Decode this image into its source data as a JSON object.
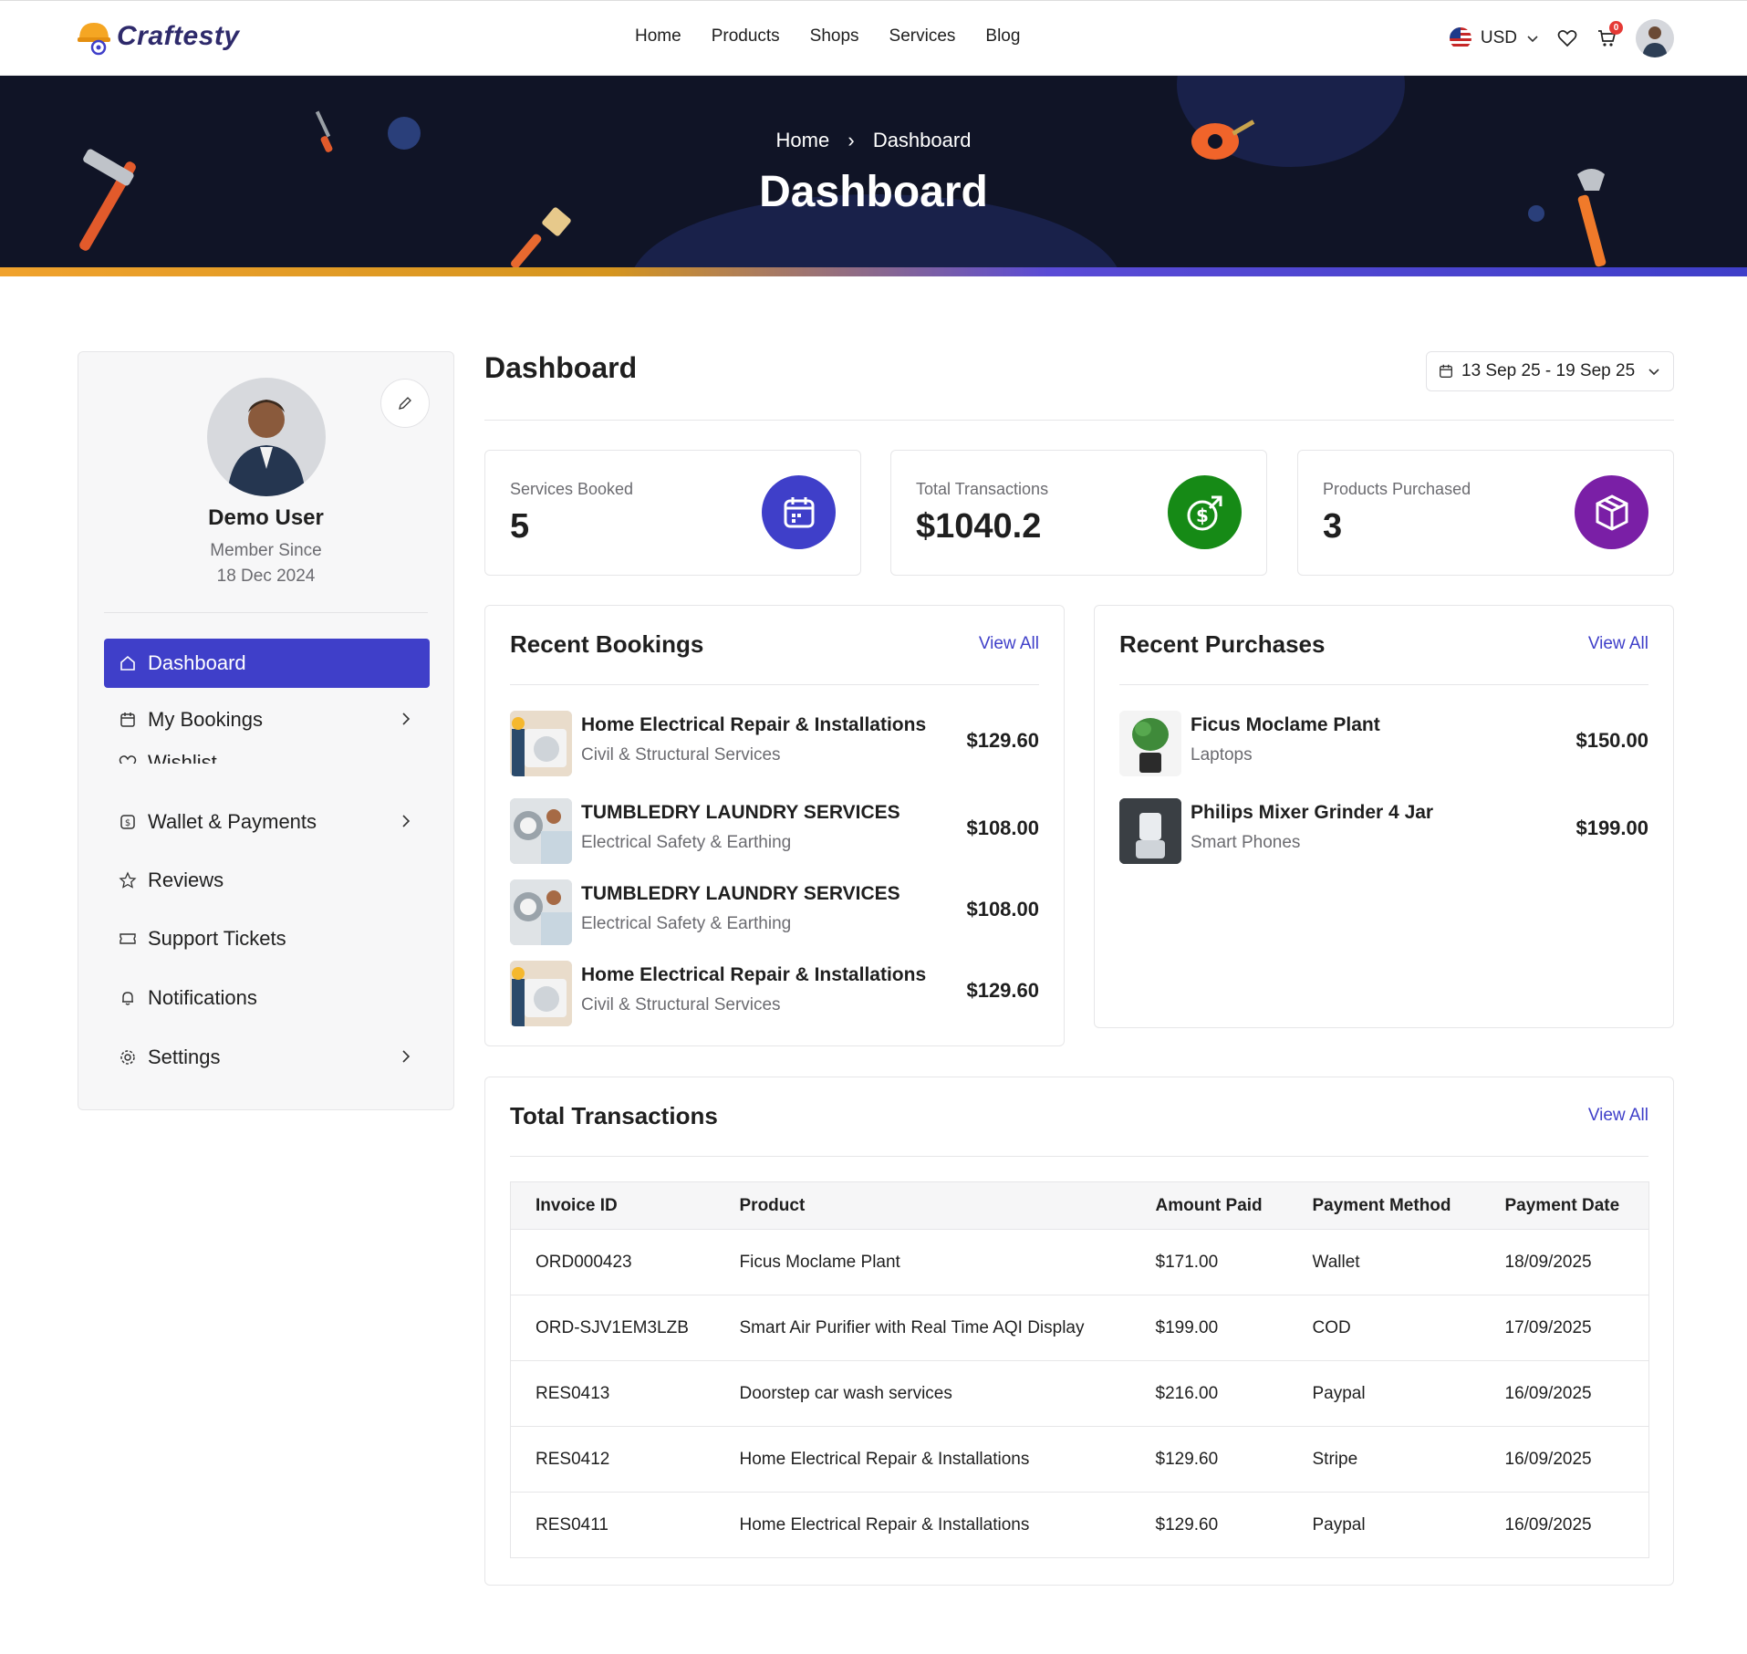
{
  "header": {
    "logo_text": "Craftesty",
    "nav": [
      "Home",
      "Products",
      "Shops",
      "Services",
      "Blog"
    ],
    "currency": "USD",
    "cart_count": "0"
  },
  "hero": {
    "breadcrumb_home": "Home",
    "breadcrumb_current": "Dashboard",
    "title": "Dashboard"
  },
  "sidebar": {
    "name": "Demo User",
    "member_since_label": "Member Since",
    "member_since_date": "18 Dec 2024",
    "items": [
      {
        "label": "Dashboard"
      },
      {
        "label": "My Bookings"
      },
      {
        "label": "Wishlist"
      },
      {
        "label": "Wallet & Payments"
      },
      {
        "label": "Reviews"
      },
      {
        "label": "Support Tickets"
      },
      {
        "label": "Notifications"
      },
      {
        "label": "Settings"
      }
    ]
  },
  "main": {
    "title": "Dashboard",
    "date_range": "13 Sep 25 - 19 Sep 25",
    "stats": [
      {
        "label": "Services Booked",
        "value": "5",
        "color": "#3f3fc9"
      },
      {
        "label": "Total Transactions",
        "value": "$1040.2",
        "color": "#168a16"
      },
      {
        "label": "Products Purchased",
        "value": "3",
        "color": "#7a1fa6"
      }
    ]
  },
  "bookings": {
    "title": "Recent Bookings",
    "view_all": "View All",
    "items": [
      {
        "title": "Home Electrical Repair & Installations",
        "sub": "Civil & Structural Services",
        "price": "$129.60"
      },
      {
        "title": "TUMBLEDRY LAUNDRY SERVICES",
        "sub": "Electrical Safety & Earthing",
        "price": "$108.00"
      },
      {
        "title": "TUMBLEDRY LAUNDRY SERVICES",
        "sub": "Electrical Safety & Earthing",
        "price": "$108.00"
      },
      {
        "title": "Home Electrical Repair & Installations",
        "sub": "Civil & Structural Services",
        "price": "$129.60"
      }
    ]
  },
  "purchases": {
    "title": "Recent Purchases",
    "view_all": "View All",
    "items": [
      {
        "title": "Ficus Moclame Plant",
        "sub": "Laptops",
        "price": "$150.00"
      },
      {
        "title": "Philips Mixer Grinder 4 Jar",
        "sub": "Smart Phones",
        "price": "$199.00"
      }
    ]
  },
  "transactions": {
    "title": "Total Transactions",
    "view_all": "View All",
    "columns": [
      "Invoice ID",
      "Product",
      "Amount Paid",
      "Payment Method",
      "Payment Date"
    ],
    "rows": [
      [
        "ORD000423",
        "Ficus Moclame Plant",
        "$171.00",
        "Wallet",
        "18/09/2025"
      ],
      [
        "ORD-SJV1EM3LZB",
        "Smart Air Purifier with Real Time AQI Display",
        "$199.00",
        "COD",
        "17/09/2025"
      ],
      [
        "RES0413",
        "Doorstep car wash services",
        "$216.00",
        "Paypal",
        "16/09/2025"
      ],
      [
        "RES0412",
        "Home Electrical Repair & Installations",
        "$129.60",
        "Stripe",
        "16/09/2025"
      ],
      [
        "RES0411",
        "Home Electrical Repair & Installations",
        "$129.60",
        "Paypal",
        "16/09/2025"
      ]
    ]
  }
}
